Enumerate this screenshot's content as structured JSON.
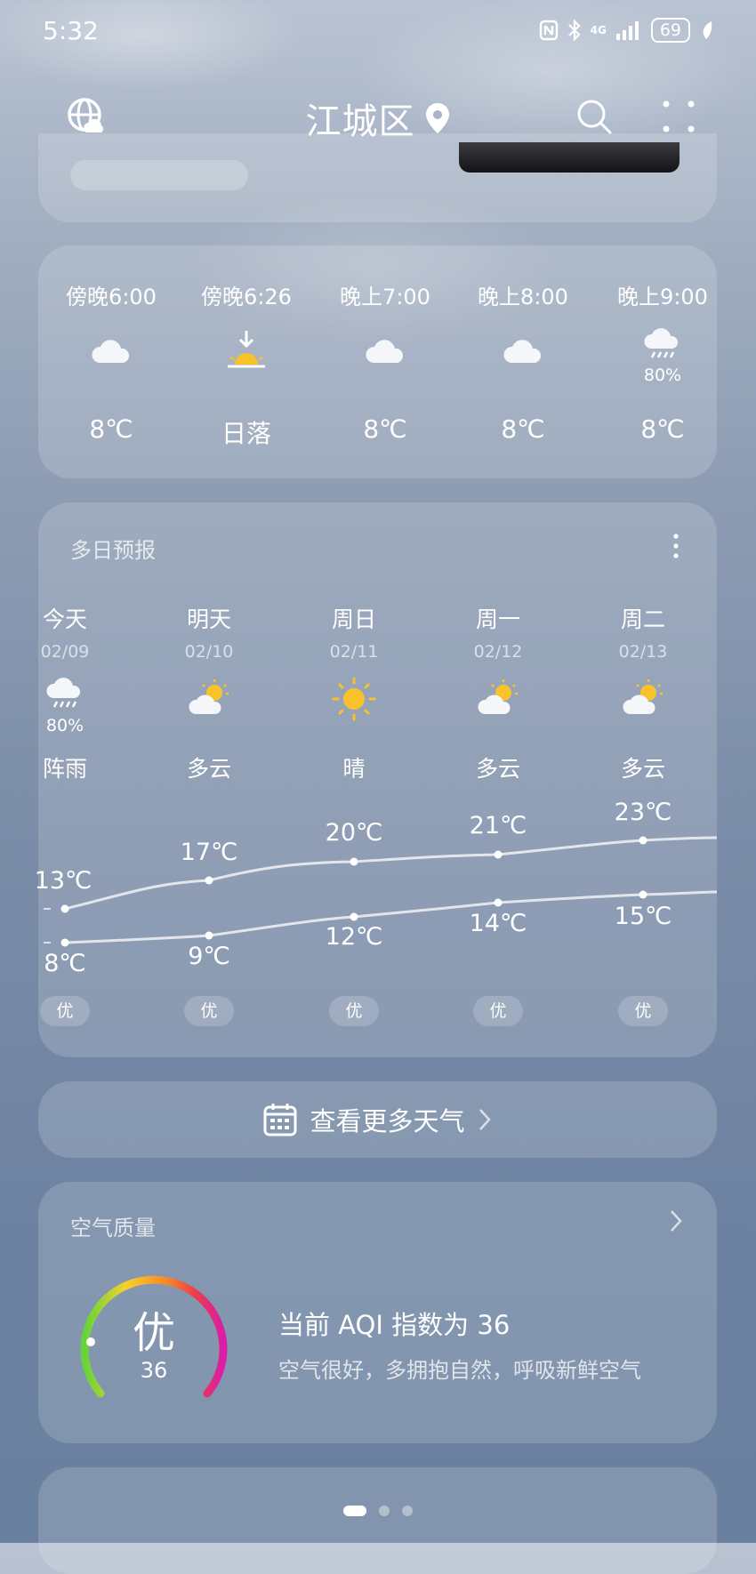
{
  "status_bar": {
    "time": "5:32",
    "network": "4G",
    "battery": "69"
  },
  "header": {
    "city": "江城区"
  },
  "hourly": [
    {
      "time": "傍晚6:00",
      "icon": "cloud-icon",
      "value": "8℃"
    },
    {
      "time": "傍晚6:26",
      "icon": "sunset-icon",
      "value": "日落"
    },
    {
      "time": "晚上7:00",
      "icon": "cloud-icon",
      "value": "8℃"
    },
    {
      "time": "晚上8:00",
      "icon": "cloud-icon",
      "value": "8℃"
    },
    {
      "time": "晚上9:00",
      "icon": "rain-icon",
      "precip": "80%",
      "value": "8℃"
    }
  ],
  "daily": {
    "title": "多日预报",
    "days": [
      {
        "name": "今天",
        "date": "02/09",
        "icon": "rain-icon",
        "precip": "80%",
        "cond": "阵雨",
        "high": "13℃",
        "low": "8℃",
        "aq": "优"
      },
      {
        "name": "明天",
        "date": "02/10",
        "icon": "partly-cloudy-icon",
        "cond": "多云",
        "high": "17℃",
        "low": "9℃",
        "aq": "优"
      },
      {
        "name": "周日",
        "date": "02/11",
        "icon": "sun-icon",
        "cond": "晴",
        "high": "20℃",
        "low": "12℃",
        "aq": "优"
      },
      {
        "name": "周一",
        "date": "02/12",
        "icon": "partly-cloudy-icon",
        "cond": "多云",
        "high": "21℃",
        "low": "14℃",
        "aq": "优"
      },
      {
        "name": "周二",
        "date": "02/13",
        "icon": "partly-cloudy-icon",
        "cond": "多云",
        "high": "23℃",
        "low": "15℃",
        "aq": "优"
      }
    ]
  },
  "more": {
    "label": "查看更多天气"
  },
  "air_quality": {
    "title": "空气质量",
    "level": "优",
    "aqi": "36",
    "main_text": "当前 AQI 指数为 36",
    "sub_text": "空气很好，多拥抱自然，呼吸新鲜空气"
  },
  "colors": {
    "accent_sun": "#f9c22b",
    "gauge_start": "#63d43b",
    "gauge_end": "#d91ea8"
  }
}
